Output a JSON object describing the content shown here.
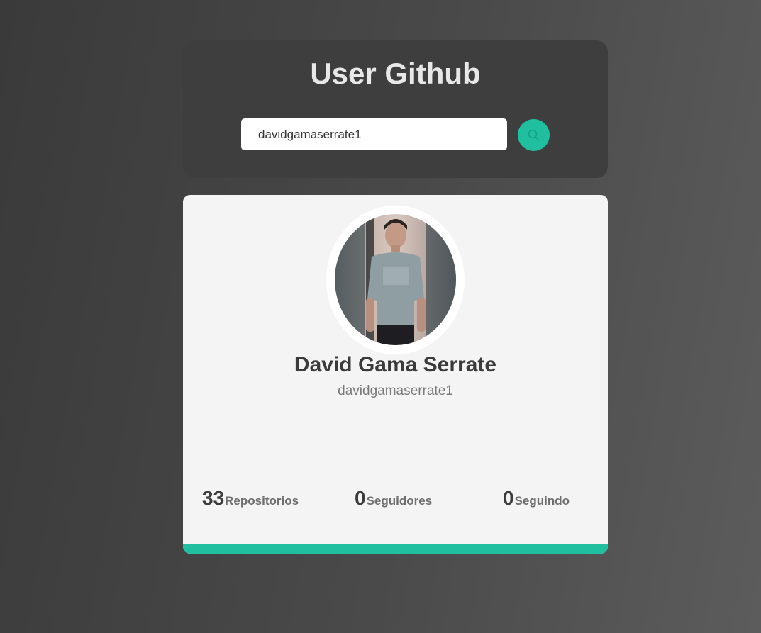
{
  "header": {
    "title": "User Github"
  },
  "search": {
    "value": "davidgamaserrate1",
    "button_icon": "search-icon"
  },
  "profile": {
    "name": "David Gama Serrate",
    "login": "davidgamaserrate1",
    "stats": {
      "repos": {
        "value": "33",
        "label": "Repositorios"
      },
      "followers": {
        "value": "0",
        "label": "Seguidores"
      },
      "following": {
        "value": "0",
        "label": "Seguindo"
      }
    }
  },
  "colors": {
    "accent": "#1fbf9f",
    "panel": "#3e3e3e",
    "card": "#f4f4f4"
  }
}
